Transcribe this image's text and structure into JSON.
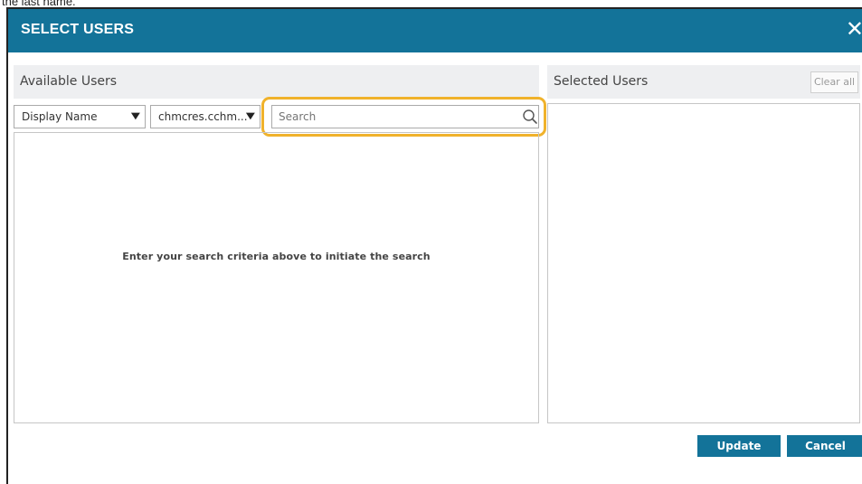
{
  "doc_fragment_text": "the last name.",
  "dialog": {
    "title": "SELECT USERS",
    "close_glyph": "✕"
  },
  "available_users": {
    "header": "Available Users",
    "filter_field": {
      "selected": "Display Name",
      "icon": "chevron-down-icon"
    },
    "domain": {
      "selected": "chmcres.cchm...",
      "icon": "chevron-down-icon"
    },
    "search": {
      "placeholder": "Search",
      "value": "",
      "icon": "search-icon"
    },
    "empty_message": "Enter your search criteria above to initiate the search"
  },
  "selected_users": {
    "header": "Selected Users",
    "clear_label": "Clear all"
  },
  "footer": {
    "update_label": "Update",
    "cancel_label": "Cancel"
  },
  "colors": {
    "titlebar": "#137399",
    "highlight": "#f0b22b",
    "panel_header": "#eeeff1"
  }
}
